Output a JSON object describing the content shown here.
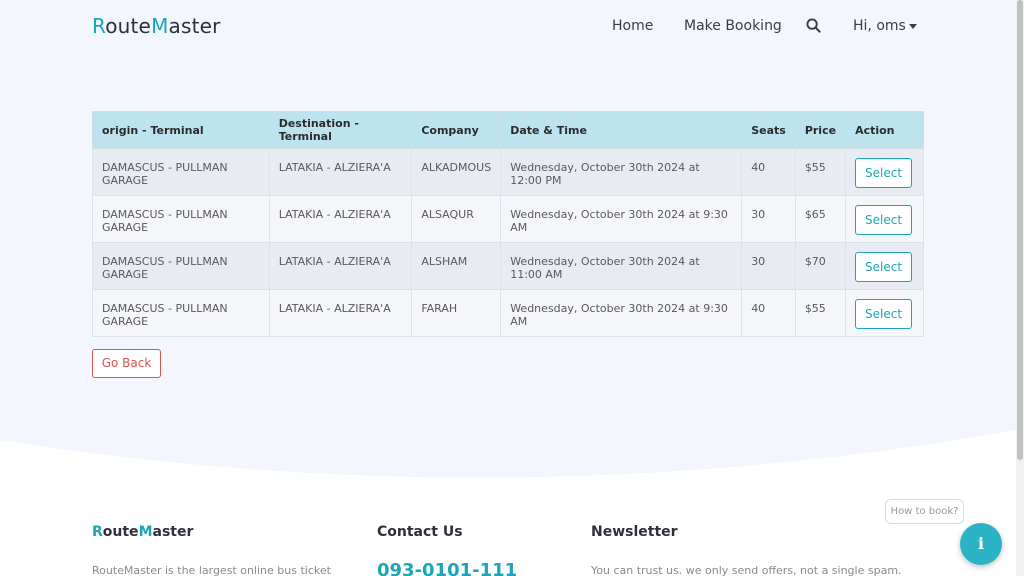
{
  "navbar": {
    "brand_r": "R",
    "brand_mid": "oute",
    "brand_m": "M",
    "brand_end": "aster",
    "home": "Home",
    "make_booking": "Make Booking",
    "search_icon": "search-icon",
    "user": "Hi, oms"
  },
  "table": {
    "headers": [
      "origin - Terminal",
      "Destination - Terminal",
      "Company",
      "Date & Time",
      "Seats",
      "Price",
      "Action"
    ],
    "rows": [
      {
        "origin": "DAMASCUS - PULLMAN GARAGE",
        "destination": "LATAKIA - ALZIERA'A",
        "company": "ALKADMOUS",
        "datetime": "Wednesday, October 30th 2024 at 12:00 PM",
        "seats": "40",
        "price": "$55",
        "action": "Select"
      },
      {
        "origin": "DAMASCUS - PULLMAN GARAGE",
        "destination": "LATAKIA - ALZIERA'A",
        "company": "ALSAQUR",
        "datetime": "Wednesday, October 30th 2024 at 9:30 AM",
        "seats": "30",
        "price": "$65",
        "action": "Select"
      },
      {
        "origin": "DAMASCUS - PULLMAN GARAGE",
        "destination": "LATAKIA - ALZIERA'A",
        "company": "ALSHAM",
        "datetime": "Wednesday, October 30th 2024 at 11:00 AM",
        "seats": "30",
        "price": "$70",
        "action": "Select"
      },
      {
        "origin": "DAMASCUS - PULLMAN GARAGE",
        "destination": "LATAKIA - ALZIERA'A",
        "company": "FARAH",
        "datetime": "Wednesday, October 30th 2024 at 9:30 AM",
        "seats": "40",
        "price": "$55",
        "action": "Select"
      }
    ]
  },
  "go_back": "Go Back",
  "footer": {
    "brand_r": "R",
    "brand_mid": "oute",
    "brand_m": "M",
    "brand_end": "aster",
    "contact_heading": "Contact Us",
    "newsletter_heading": "Newsletter",
    "about_text": "RouteMaster is the largest online bus ticket",
    "phone": "093-0101-111",
    "newsletter_text": "You can trust us. we only send offers, not a single spam."
  },
  "how_to_book": "How to book?",
  "info_button": "i",
  "colors": {
    "accent": "#1aa6b7",
    "danger": "#d9534f",
    "header_bg": "#bde4ee",
    "page_bg": "#f3f6fc"
  }
}
